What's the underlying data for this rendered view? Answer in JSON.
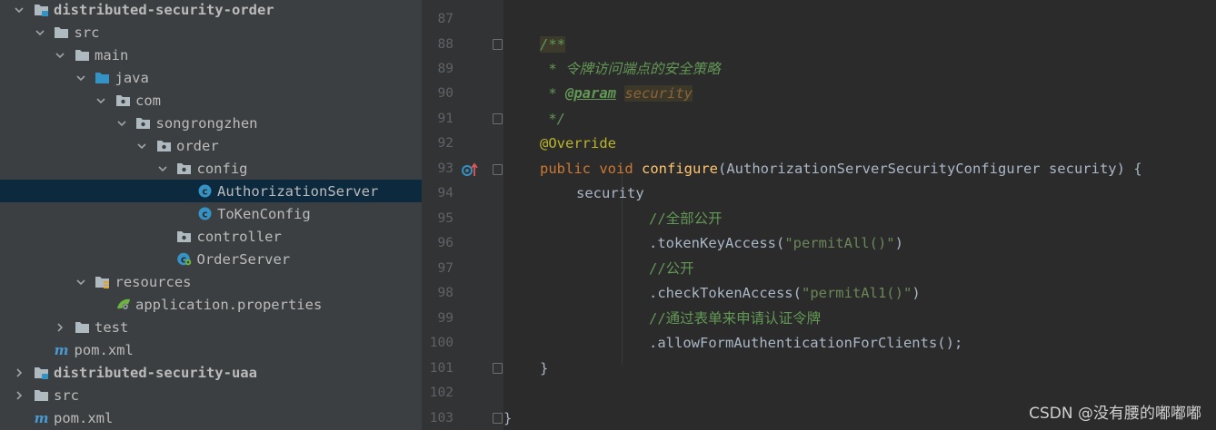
{
  "project_tree": {
    "items": [
      {
        "label": "distributed-security-order",
        "expanded": true,
        "icon": "module-folder-icon",
        "bold": true
      },
      {
        "label": "src",
        "expanded": true,
        "icon": "folder-icon"
      },
      {
        "label": "main",
        "expanded": true,
        "icon": "folder-icon"
      },
      {
        "label": "java",
        "expanded": true,
        "icon": "source-folder-icon"
      },
      {
        "label": "com",
        "expanded": true,
        "icon": "package-icon"
      },
      {
        "label": "songrongzhen",
        "expanded": true,
        "icon": "package-icon"
      },
      {
        "label": "order",
        "expanded": true,
        "icon": "package-icon"
      },
      {
        "label": "config",
        "expanded": true,
        "icon": "package-icon"
      },
      {
        "label": "AuthorizationServer",
        "icon": "class-icon",
        "selected": true
      },
      {
        "label": "ToKenConfig",
        "icon": "class-icon"
      },
      {
        "label": "controller",
        "icon": "package-icon"
      },
      {
        "label": "OrderServer",
        "icon": "spring-boot-class-icon"
      },
      {
        "label": "resources",
        "expanded": true,
        "icon": "resources-folder-icon"
      },
      {
        "label": "application.properties",
        "icon": "spring-properties-icon"
      },
      {
        "label": "test",
        "expanded": false,
        "icon": "folder-icon"
      },
      {
        "label": "pom.xml",
        "icon": "maven-icon"
      },
      {
        "label": "distributed-security-uaa",
        "expanded": false,
        "icon": "module-folder-icon",
        "bold": true
      },
      {
        "label": "src",
        "expanded": false,
        "icon": "folder-icon"
      },
      {
        "label": "pom.xml",
        "icon": "maven-icon"
      }
    ]
  },
  "editor": {
    "line_numbers": [
      "87",
      "88",
      "89",
      "90",
      "91",
      "92",
      "93",
      "94",
      "95",
      "96",
      "97",
      "98",
      "99",
      "100",
      "101",
      "102",
      "103"
    ],
    "code": {
      "l88_doc_open": "/**",
      "l89_doc_star": " * ",
      "l89_doc_text": "令牌访问端点的安全策略",
      "l90_doc_star": " * ",
      "l90_param_tag": "@param",
      "l90_param_name": "security",
      "l91_doc_close": " */",
      "l92_annotation": "@Override",
      "l93_public": "public",
      "l93_void": "void",
      "l93_method": "configure",
      "l93_params": "(AuthorizationServerSecurityConfigurer security) {",
      "l94_security": "security",
      "l95_comment": "//全部公开",
      "l96_call": ".tokenKeyAccess(",
      "l96_str": "\"permitAll()\"",
      "l96_end": ")",
      "l97_comment": "//公开",
      "l98_call": ".checkTokenAccess(",
      "l98_str": "\"permitAl1()\"",
      "l98_end": ")",
      "l99_comment": "//通过表单来申请认证令牌",
      "l100_call": ".allowFormAuthenticationForClients();",
      "l101_close": "}",
      "l103_close": "}"
    }
  },
  "watermark": "CSDN @没有腰的嘟嘟嘟",
  "colors": {
    "tree_bg": "#3c3f41",
    "selected_row": "#0d293e",
    "editor_bg": "#2b2b2b",
    "keyword": "#cc7832",
    "method": "#ffc66d",
    "string": "#6a8759",
    "annotation": "#bbb529",
    "comment": "#629755"
  }
}
